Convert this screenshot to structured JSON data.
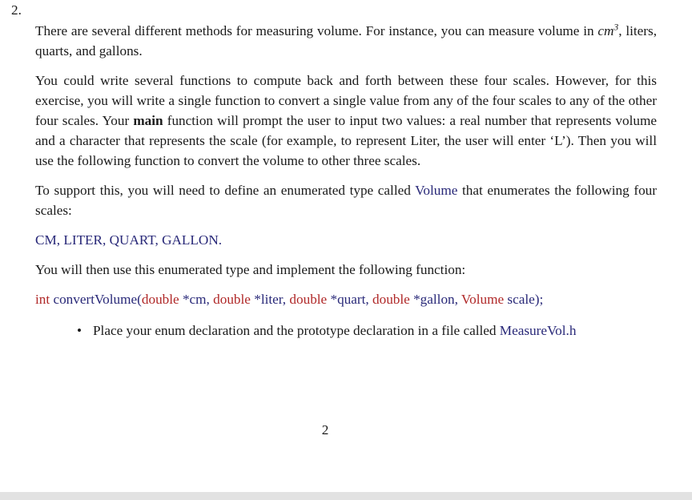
{
  "document": {
    "item_number": "2.",
    "paragraph_1": {
      "text_a": "There are several different methods for measuring volume.  For instance, you can measure volume in ",
      "italic_unit": "cm",
      "superscript": "3",
      "text_b": ", liters, quarts, and gallons."
    },
    "paragraph_2": {
      "text_a": "You could write several functions to compute back and forth between these four scales. However, for this exercise, you will write a single function to convert a single value from any of the four scales to any of the other four scales. Your ",
      "bold_word": "main",
      "text_b": " function will prompt the user to input two values: a real number that represents volume and a character that represents the scale (for example, to represent Liter, the user will enter ‘L’). Then you will use the following function to convert the volume to other three scales."
    },
    "paragraph_3": {
      "text_a": "To support this, you will need to define an enumerated type called ",
      "type_name": "Volume",
      "text_b": " that enumerates the following four scales:"
    },
    "enum_values": "CM, LITER, QUART, GALLON.",
    "paragraph_4": "You will then use this enumerated type and implement the following function:",
    "function_signature": {
      "return_type": "int",
      "function_name": " convertVolume(",
      "param1_type": "double",
      "param1_name": " *cm, ",
      "param2_type": "double",
      "param2_name": " *liter, ",
      "param3_type": "double",
      "param3_name": " *quart, ",
      "param4_type": "double",
      "param4_name": " *gallon, ",
      "param5_type": "Volume",
      "param5_name": "scale);"
    },
    "bullets": [
      {
        "marker": "•",
        "text_a": "Place your enum declaration and the prototype declaration in a file called ",
        "filename": "MeasureVol.h"
      }
    ],
    "page_number": "2"
  },
  "colors": {
    "text": "#1a1a1a",
    "blue": "#282878",
    "red": "#b02828",
    "bottom_strip": "#e2e2e2",
    "background": "#ffffff"
  }
}
